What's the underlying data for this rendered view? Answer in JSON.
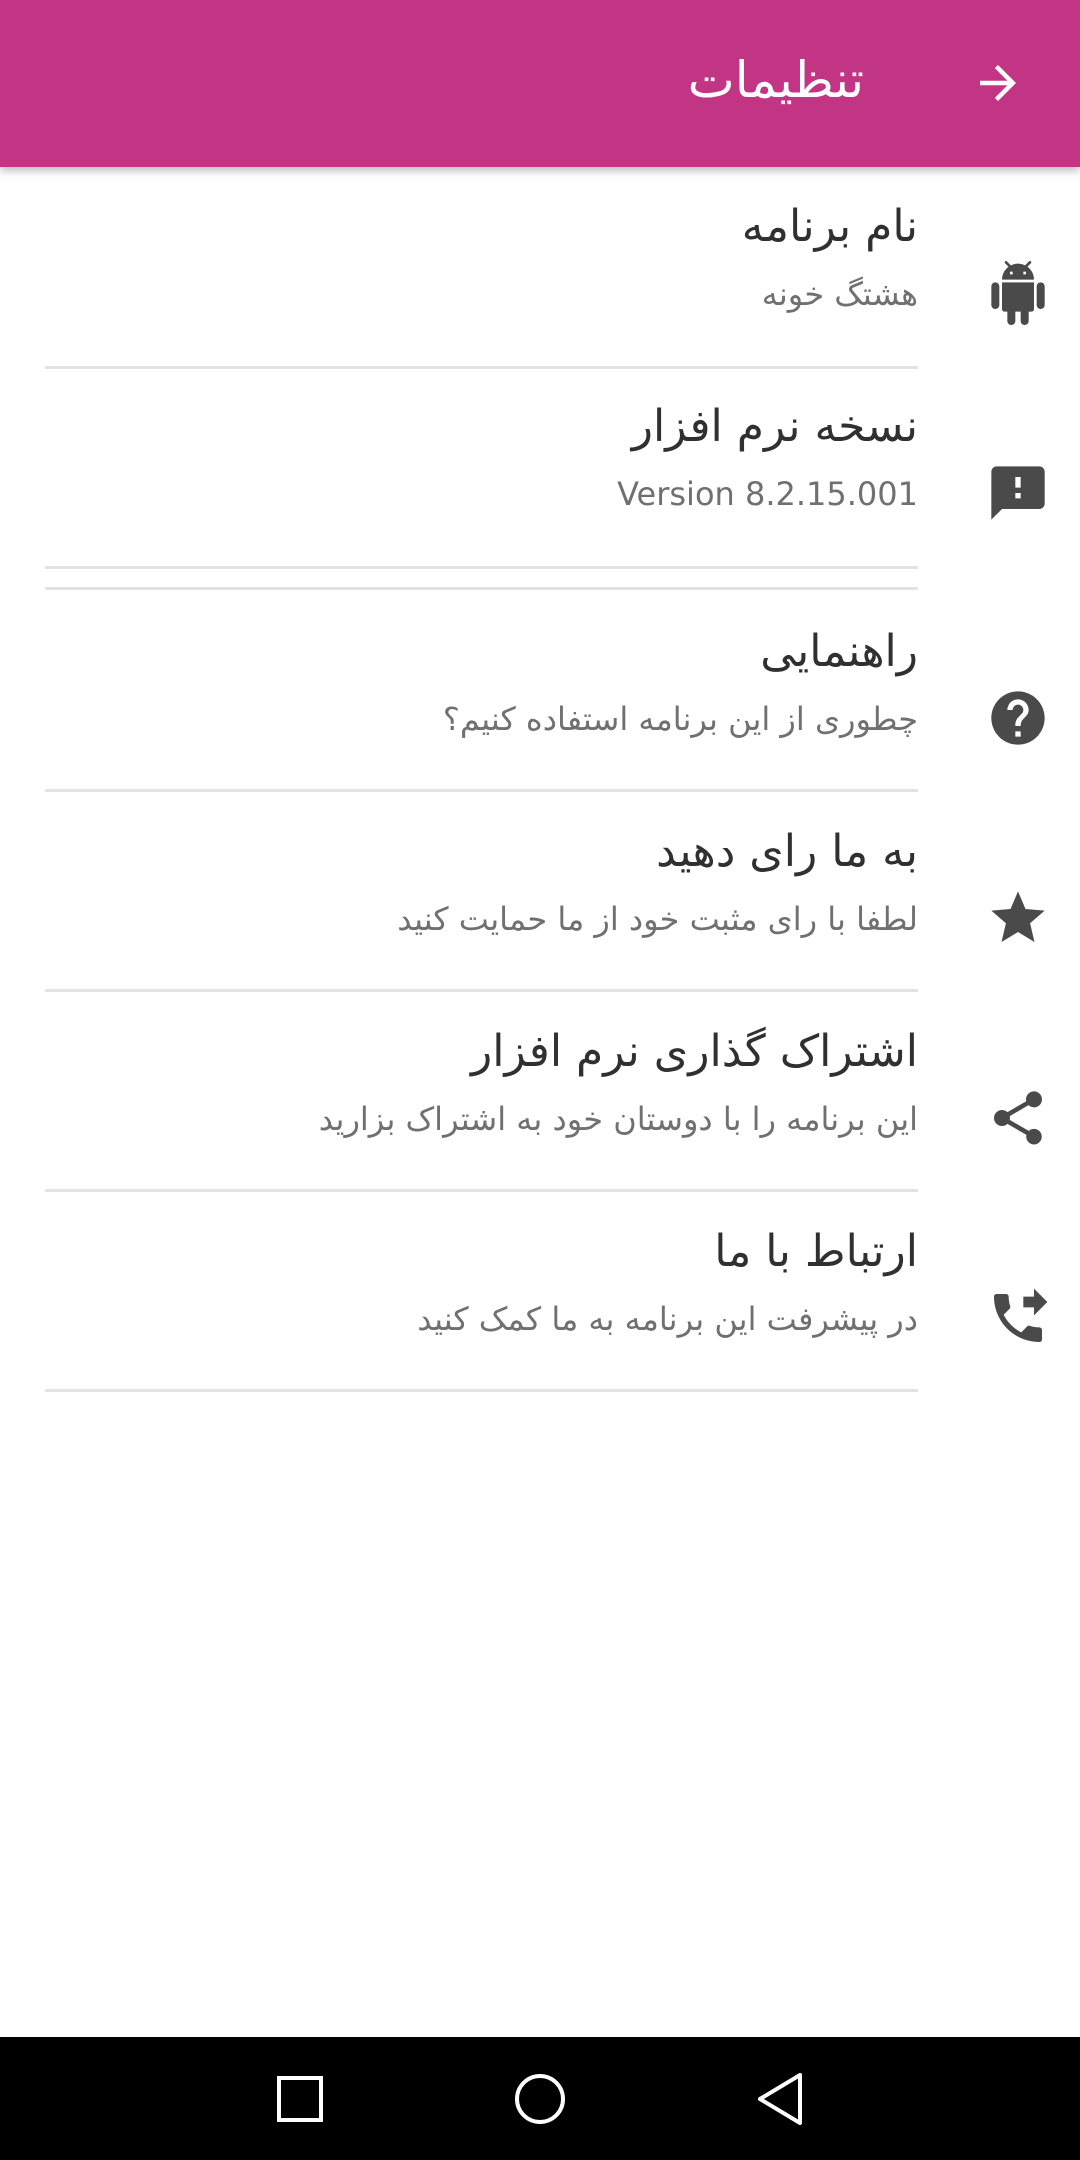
{
  "theme": {
    "accent": "#c13584",
    "icon_color": "#4a4a4a",
    "divider": "#e3e3e3"
  },
  "header": {
    "title": "تنظیمات",
    "back_icon": "arrow-right-icon"
  },
  "settings": {
    "items": [
      {
        "title": "نام برنامه",
        "subtitle": "هشتگ خونه",
        "icon": "android-icon"
      },
      {
        "title": "نسخه نرم افزار",
        "subtitle": "Version 8.2.15.001",
        "icon": "feedback-icon"
      },
      {
        "title": "راهنمایی",
        "subtitle": "چطوری از این برنامه استفاده کنیم؟",
        "icon": "help-icon"
      },
      {
        "title": "به ما رای دهید",
        "subtitle": "لطفا با رای مثبت خود از ما حمایت کنید",
        "icon": "star-icon"
      },
      {
        "title": "اشتراک گذاری نرم افزار",
        "subtitle": "این برنامه را با دوستان خود به اشتراک بزارید",
        "icon": "share-icon"
      },
      {
        "title": "ارتباط با ما",
        "subtitle": "در پیشرفت این برنامه به ما کمک کنید",
        "icon": "phone-forwarded-icon"
      }
    ]
  },
  "navbar": {
    "icons": [
      "recent-apps-icon",
      "home-icon",
      "back-icon"
    ]
  }
}
